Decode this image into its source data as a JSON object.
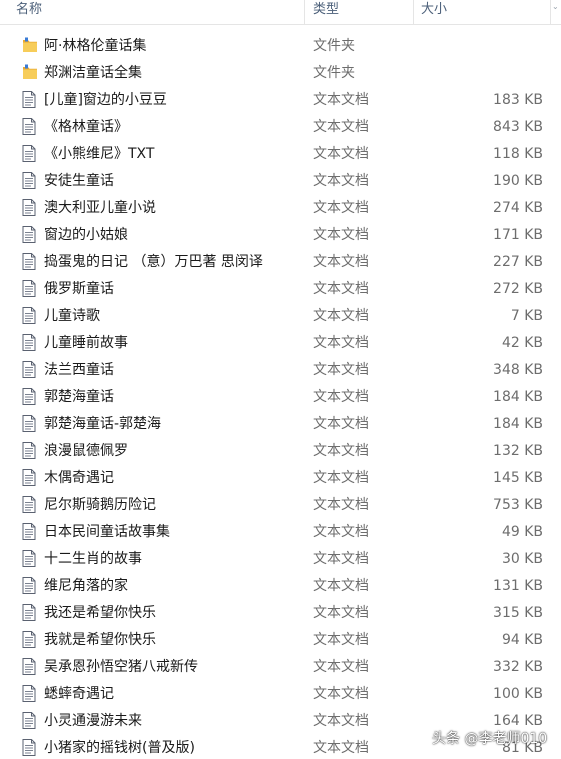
{
  "header": {
    "name_label": "名称",
    "type_label": "类型",
    "size_label": "大小"
  },
  "colors": {
    "folder": "#f2c14e",
    "doc_stroke": "#5a6170",
    "header_text": "#4c607a"
  },
  "files": [
    {
      "name": "阿·林格伦童话集",
      "type": "文件夹",
      "size": "",
      "icon": "folder-icon"
    },
    {
      "name": "郑渊洁童话全集",
      "type": "文件夹",
      "size": "",
      "icon": "folder-icon"
    },
    {
      "name": "[儿童]窗边的小豆豆",
      "type": "文本文档",
      "size": "183 KB",
      "icon": "text-file-icon"
    },
    {
      "name": "《格林童话》",
      "type": "文本文档",
      "size": "843 KB",
      "icon": "text-file-icon"
    },
    {
      "name": "《小熊维尼》TXT",
      "type": "文本文档",
      "size": "118 KB",
      "icon": "text-file-icon"
    },
    {
      "name": "安徒生童话",
      "type": "文本文档",
      "size": "190 KB",
      "icon": "text-file-icon"
    },
    {
      "name": "澳大利亚儿童小说",
      "type": "文本文档",
      "size": "274 KB",
      "icon": "text-file-icon"
    },
    {
      "name": "窗边的小姑娘",
      "type": "文本文档",
      "size": "171 KB",
      "icon": "text-file-icon"
    },
    {
      "name": "捣蛋鬼的日记 （意）万巴著 思闵译",
      "type": "文本文档",
      "size": "227 KB",
      "icon": "text-file-icon"
    },
    {
      "name": "俄罗斯童话",
      "type": "文本文档",
      "size": "272 KB",
      "icon": "text-file-icon"
    },
    {
      "name": "儿童诗歌",
      "type": "文本文档",
      "size": "7 KB",
      "icon": "text-file-icon"
    },
    {
      "name": "儿童睡前故事",
      "type": "文本文档",
      "size": "42 KB",
      "icon": "text-file-icon"
    },
    {
      "name": "法兰西童话",
      "type": "文本文档",
      "size": "348 KB",
      "icon": "text-file-icon"
    },
    {
      "name": "郭楚海童话",
      "type": "文本文档",
      "size": "184 KB",
      "icon": "text-file-icon"
    },
    {
      "name": "郭楚海童话-郭楚海",
      "type": "文本文档",
      "size": "184 KB",
      "icon": "text-file-icon"
    },
    {
      "name": "浪漫鼠德佩罗",
      "type": "文本文档",
      "size": "132 KB",
      "icon": "text-file-icon"
    },
    {
      "name": "木偶奇遇记",
      "type": "文本文档",
      "size": "145 KB",
      "icon": "text-file-icon"
    },
    {
      "name": "尼尔斯骑鹅历险记",
      "type": "文本文档",
      "size": "753 KB",
      "icon": "text-file-icon"
    },
    {
      "name": "日本民间童话故事集",
      "type": "文本文档",
      "size": "49 KB",
      "icon": "text-file-icon"
    },
    {
      "name": "十二生肖的故事",
      "type": "文本文档",
      "size": "30 KB",
      "icon": "text-file-icon"
    },
    {
      "name": "维尼角落的家",
      "type": "文本文档",
      "size": "131 KB",
      "icon": "text-file-icon"
    },
    {
      "name": "我还是希望你快乐",
      "type": "文本文档",
      "size": "315 KB",
      "icon": "text-file-icon"
    },
    {
      "name": "我就是希望你快乐",
      "type": "文本文档",
      "size": "94 KB",
      "icon": "text-file-icon"
    },
    {
      "name": "吴承恩孙悟空猪八戒新传",
      "type": "文本文档",
      "size": "332 KB",
      "icon": "text-file-icon"
    },
    {
      "name": "蟋蟀奇遇记",
      "type": "文本文档",
      "size": "100 KB",
      "icon": "text-file-icon"
    },
    {
      "name": "小灵通漫游未来",
      "type": "文本文档",
      "size": "164 KB",
      "icon": "text-file-icon"
    },
    {
      "name": "小猪家的摇钱树(普及版)",
      "type": "文本文档",
      "size": "81 KB",
      "icon": "text-file-icon"
    }
  ],
  "watermark": "头条 @李老师010"
}
